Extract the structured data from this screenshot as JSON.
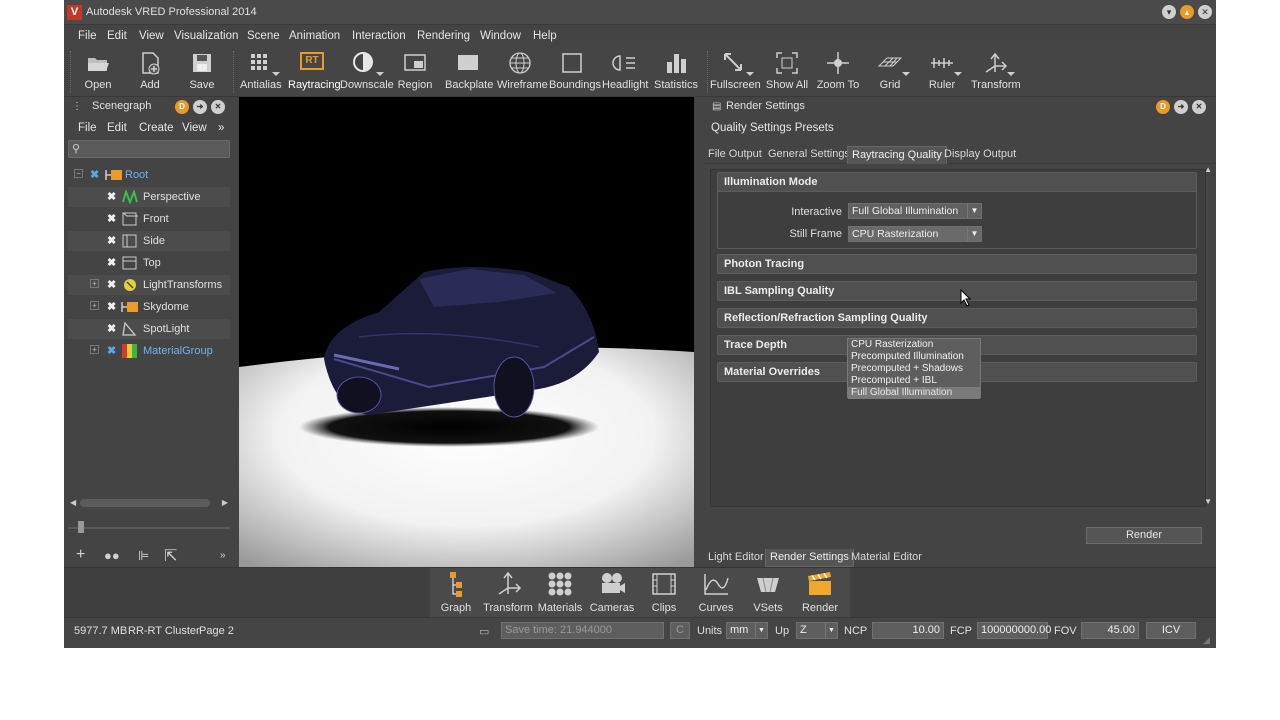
{
  "window": {
    "title": "Autodesk VRED Professional 2014",
    "logo": "V"
  },
  "menubar": [
    "File",
    "Edit",
    "View",
    "Visualization",
    "Scene",
    "Animation",
    "Interaction",
    "Rendering",
    "Window",
    "Help"
  ],
  "toolbar": {
    "left": [
      "Open",
      "Add",
      "Save"
    ],
    "render": [
      "Antialias",
      "Raytracing",
      "Downscale",
      "Region",
      "Backplate",
      "Wireframe",
      "Boundings",
      "Headlight",
      "Statistics"
    ],
    "right": [
      "Fullscreen",
      "Show All",
      "Zoom To",
      "Grid",
      "Ruler",
      "Transform"
    ],
    "raytracing_badge": "RT"
  },
  "scenegraph": {
    "title": "Scenegraph",
    "menu": [
      "File",
      "Edit",
      "Create",
      "View"
    ],
    "more": "»",
    "tree": [
      {
        "label": "Root",
        "icon": "group-icon"
      },
      {
        "label": "Perspective",
        "icon": "camera-icon"
      },
      {
        "label": "Front",
        "icon": "camera-icon"
      },
      {
        "label": "Side",
        "icon": "camera-icon"
      },
      {
        "label": "Top",
        "icon": "camera-icon"
      },
      {
        "label": "LightTransforms",
        "icon": "light-icon"
      },
      {
        "label": "Skydome",
        "icon": "group-icon"
      },
      {
        "label": "SpotLight",
        "icon": "spotlight-icon"
      },
      {
        "label": "MaterialGroup",
        "icon": "material-icon"
      }
    ]
  },
  "render_settings": {
    "title": "Render Settings",
    "presets": "Quality Settings Presets",
    "tabs": [
      "File Output",
      "General Settings",
      "Raytracing Quality",
      "Display Output"
    ],
    "active_tab": "Raytracing Quality",
    "illumination": {
      "title": "Illumination Mode",
      "interactive_label": "Interactive",
      "interactive_value": "Full Global Illumination",
      "still_label": "Still Frame",
      "still_value": "CPU Rasterization",
      "options": [
        "CPU Rasterization",
        "Precomputed Illumination",
        "Precomputed + Shadows",
        "Precomputed + IBL",
        "Full Global Illumination"
      ],
      "highlighted_option": "Full Global Illumination"
    },
    "sections": [
      "Photon Tracing",
      "IBL Sampling Quality",
      "Reflection/Refraction Sampling Quality",
      "Trace Depth",
      "Material Overrides"
    ],
    "render_button": "Render",
    "bottom_tabs": [
      "Light Editor",
      "Render Settings",
      "Material Editor"
    ],
    "active_bottom_tab": "Render Settings"
  },
  "dock": [
    "Graph",
    "Transform",
    "Materials",
    "Cameras",
    "Clips",
    "Curves",
    "VSets",
    "Render"
  ],
  "statusbar": {
    "memory": "5977.7 MB",
    "cluster": "RR-RT Cluster",
    "page": "Page 2",
    "save_time": "Save time: 21.944000",
    "c_label": "C",
    "units_label": "Units",
    "units_value": "mm",
    "up_label": "Up",
    "up_value": "Z",
    "ncp_label": "NCP",
    "ncp_value": "10.00",
    "fcp_label": "FCP",
    "fcp_value": "100000000.00",
    "fov_label": "FOV",
    "fov_value": "45.00",
    "icv": "ICV"
  },
  "colors": {
    "accent": "#e89b2a",
    "blue": "#5aa6e8",
    "panel": "#444444",
    "viewport_bg": "#000000"
  }
}
